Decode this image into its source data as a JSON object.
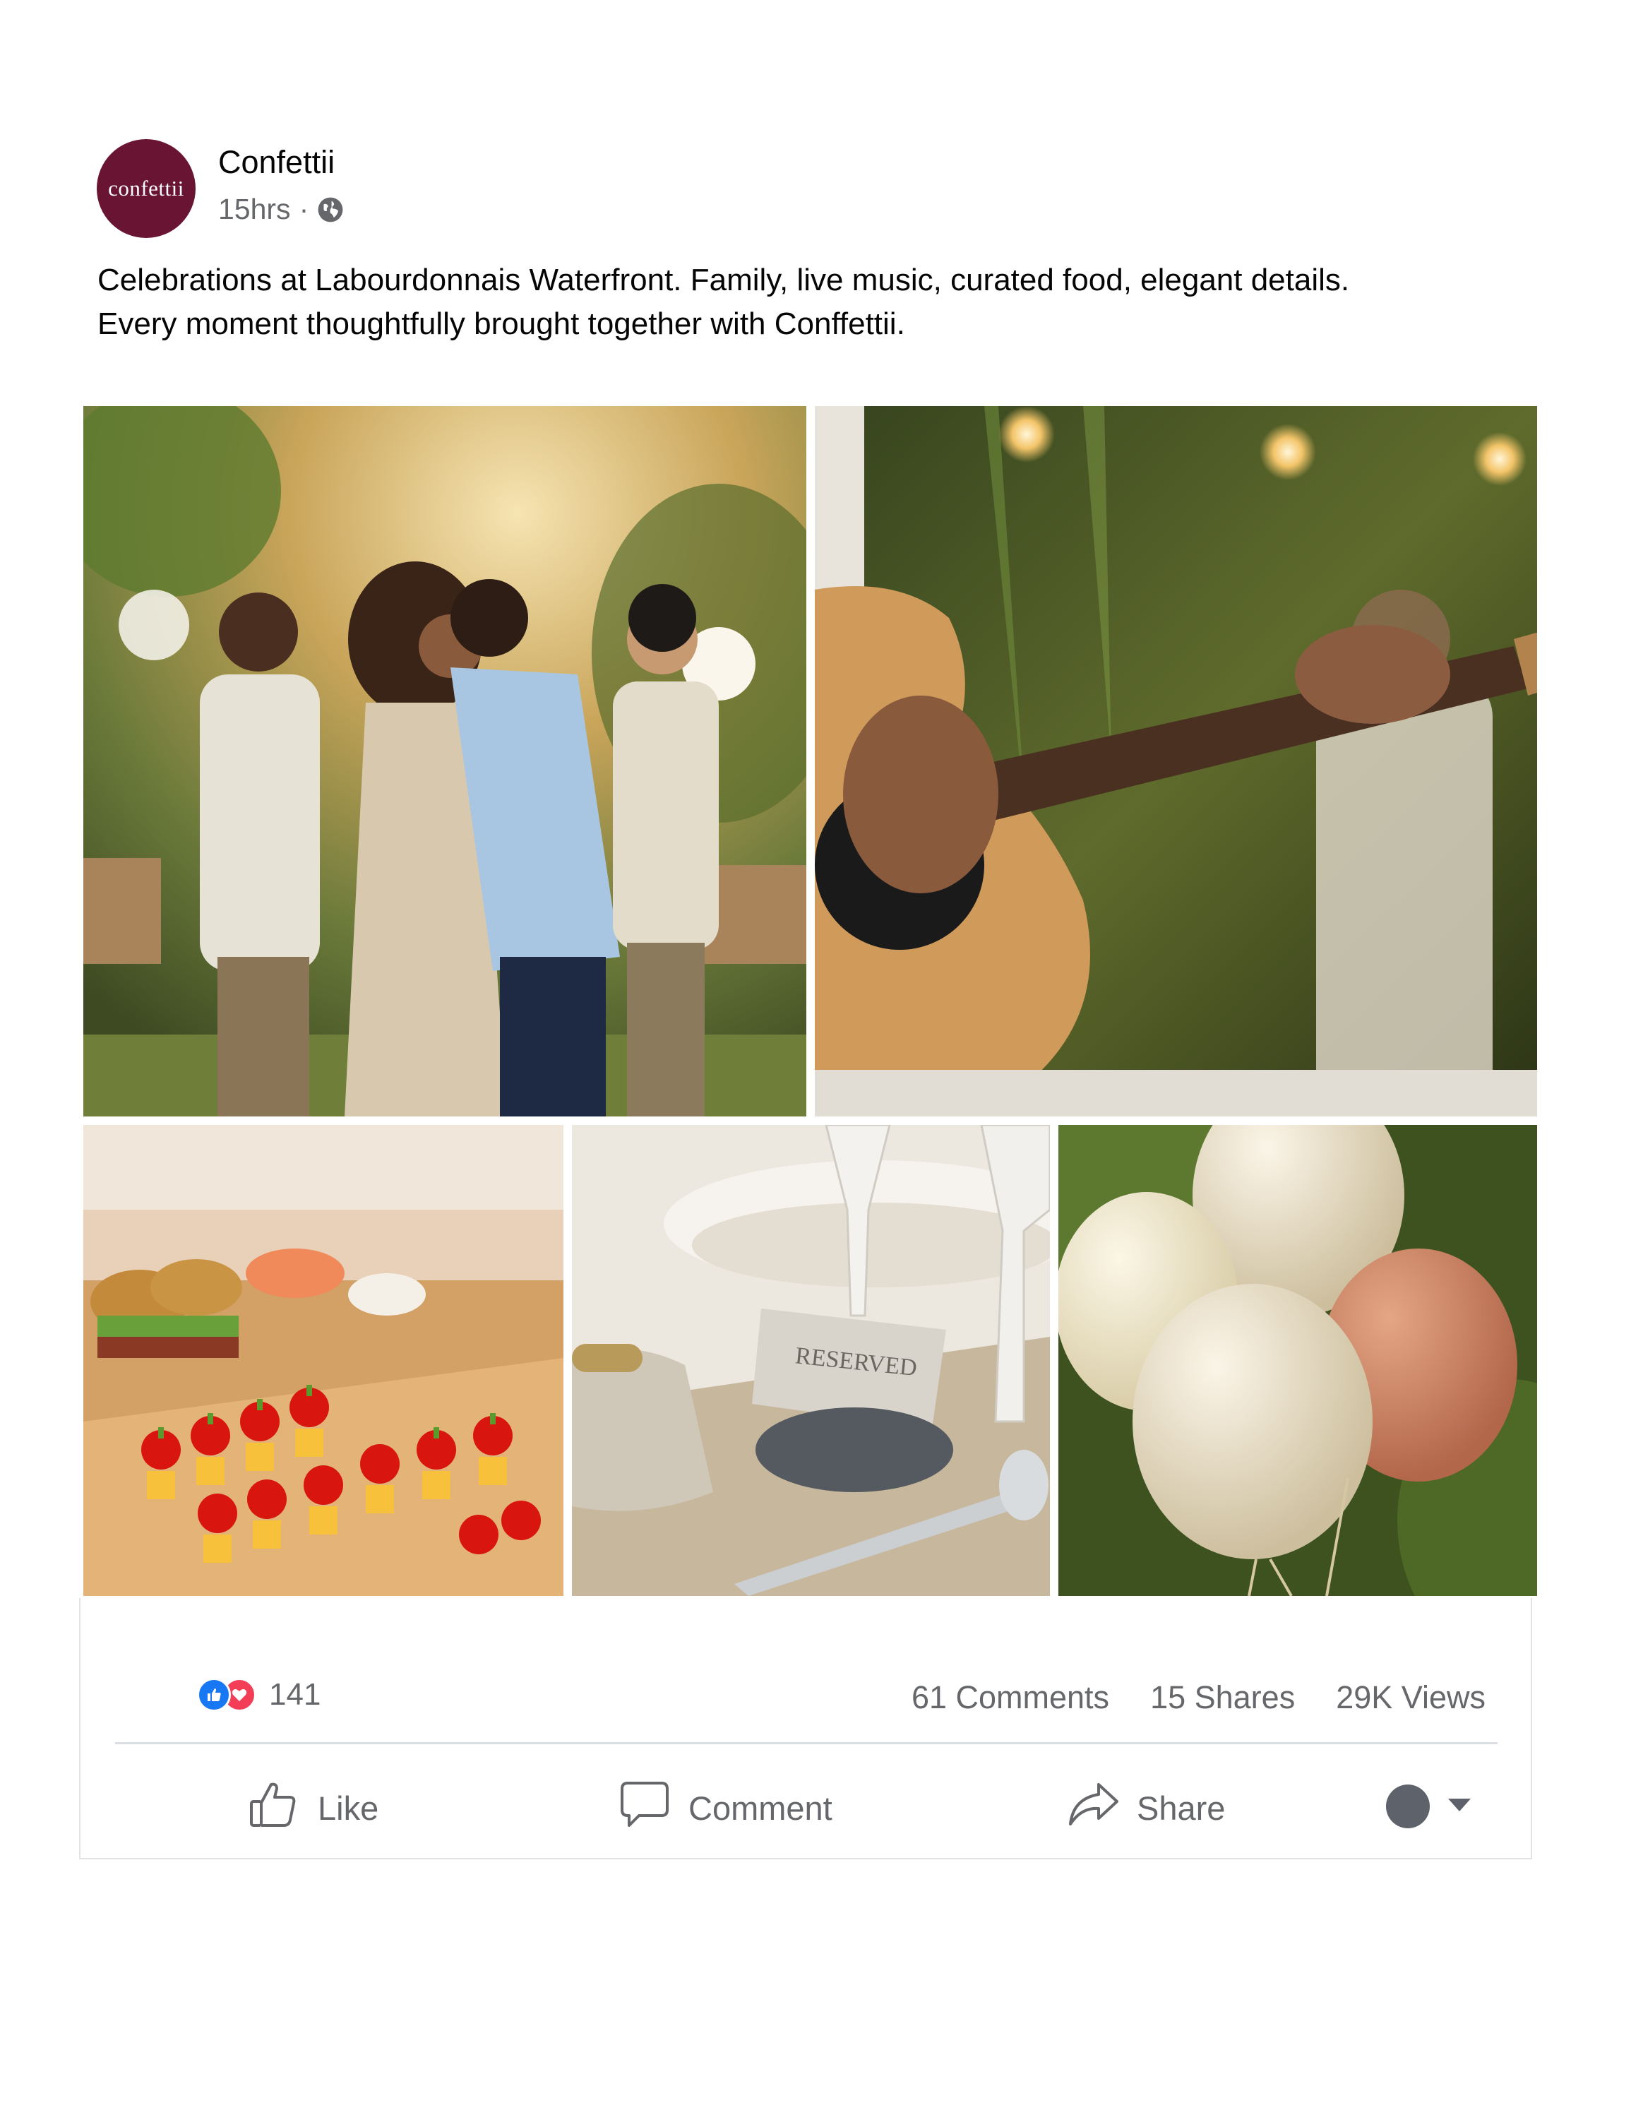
{
  "post": {
    "author": {
      "name": "Confettii",
      "avatar_text": "confettii",
      "avatar_color": "#6a1433"
    },
    "timestamp": "15hrs",
    "separator": "·",
    "privacy_icon": "globe-icon",
    "caption_lines": [
      "Celebrations at Labourdonnais Waterfront. Family, live music, curated food, elegant details.",
      "Every moment thoughtfully brought together with Conffettii."
    ],
    "photos": [
      {
        "subject": "guests-greeting",
        "icon": "photo"
      },
      {
        "subject": "guitar-player",
        "icon": "photo"
      },
      {
        "subject": "food-platter",
        "icon": "photo"
      },
      {
        "subject": "reserved-table-card",
        "icon": "photo",
        "card_text": "RESERVED"
      },
      {
        "subject": "balloons",
        "icon": "photo"
      }
    ]
  },
  "engagement": {
    "reaction_icons": [
      "like-icon",
      "love-icon"
    ],
    "reaction_count": "141",
    "comments": "61 Comments",
    "shares": "15 Shares",
    "views": "29K Views"
  },
  "actions": {
    "like_label": "Like",
    "comment_label": "Comment",
    "share_label": "Share"
  },
  "colors": {
    "text_primary": "#050505",
    "text_secondary": "#65676b",
    "like_blue": "#1877f2",
    "love_red": "#f33e58",
    "divider": "#dadde1"
  }
}
